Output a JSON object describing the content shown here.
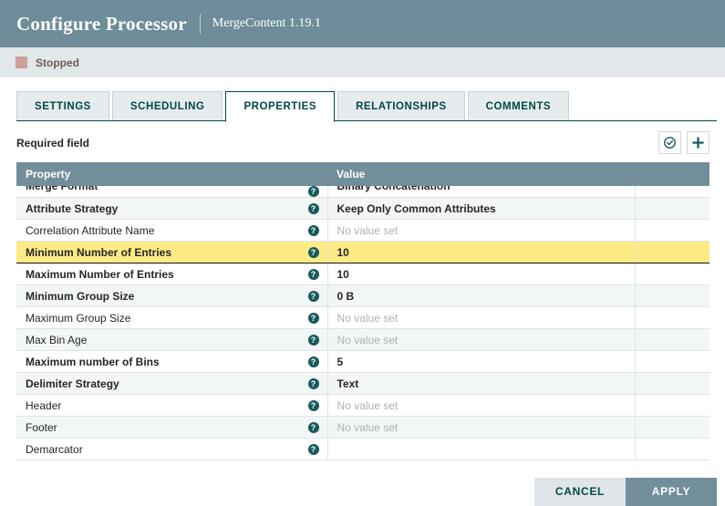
{
  "header": {
    "title": "Configure Processor",
    "subtitle": "MergeContent 1.19.1"
  },
  "status": {
    "label": "Stopped",
    "indicator_color": "#cf9f9c"
  },
  "tabs": [
    {
      "label": "SETTINGS",
      "active": false
    },
    {
      "label": "SCHEDULING",
      "active": false
    },
    {
      "label": "PROPERTIES",
      "active": true
    },
    {
      "label": "RELATIONSHIPS",
      "active": false
    },
    {
      "label": "COMMENTS",
      "active": false
    }
  ],
  "toolbar": {
    "required_field_label": "Required field",
    "verify_icon": "check-circle-icon",
    "add_icon": "plus-icon"
  },
  "table": {
    "columns": [
      "Property",
      "Value",
      ""
    ],
    "help_glyph": "?",
    "rows": [
      {
        "property": "Merge Format",
        "required": true,
        "value": "Binary Concatenation",
        "value_set": true,
        "selected": false,
        "clipped": true
      },
      {
        "property": "Attribute Strategy",
        "required": true,
        "value": "Keep Only Common Attributes",
        "value_set": true,
        "selected": false,
        "clipped": false
      },
      {
        "property": "Correlation Attribute Name",
        "required": false,
        "value": "No value set",
        "value_set": false,
        "selected": false,
        "clipped": false
      },
      {
        "property": "Minimum Number of Entries",
        "required": true,
        "value": "10",
        "value_set": true,
        "selected": true,
        "clipped": false
      },
      {
        "property": "Maximum Number of Entries",
        "required": true,
        "value": "10",
        "value_set": true,
        "selected": false,
        "clipped": false
      },
      {
        "property": "Minimum Group Size",
        "required": true,
        "value": "0 B",
        "value_set": true,
        "selected": false,
        "clipped": false
      },
      {
        "property": "Maximum Group Size",
        "required": false,
        "value": "No value set",
        "value_set": false,
        "selected": false,
        "clipped": false
      },
      {
        "property": "Max Bin Age",
        "required": false,
        "value": "No value set",
        "value_set": false,
        "selected": false,
        "clipped": false
      },
      {
        "property": "Maximum number of Bins",
        "required": true,
        "value": "5",
        "value_set": true,
        "selected": false,
        "clipped": false
      },
      {
        "property": "Delimiter Strategy",
        "required": true,
        "value": "Text",
        "value_set": true,
        "selected": false,
        "clipped": false
      },
      {
        "property": "Header",
        "required": false,
        "value": "No value set",
        "value_set": false,
        "selected": false,
        "clipped": false
      },
      {
        "property": "Footer",
        "required": false,
        "value": "No value set",
        "value_set": false,
        "selected": false,
        "clipped": false
      },
      {
        "property": "Demarcator",
        "required": false,
        "value": "",
        "value_set": true,
        "selected": false,
        "clipped": false
      }
    ]
  },
  "footer": {
    "cancel_label": "CANCEL",
    "apply_label": "APPLY"
  },
  "colors": {
    "header_bg": "#6e8c99",
    "table_header_bg": "#728e9b",
    "accent_teal": "#004849",
    "selected_row": "#ffeb85",
    "apply_bg": "#728e9b"
  }
}
